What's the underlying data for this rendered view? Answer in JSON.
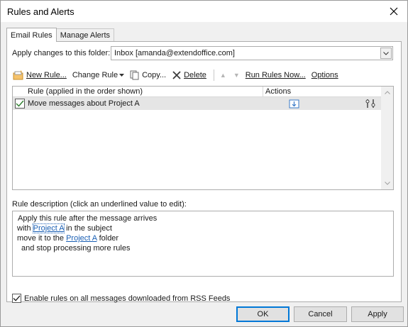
{
  "window": {
    "title": "Rules and Alerts"
  },
  "tabs": [
    {
      "label": "Email Rules",
      "active": true
    },
    {
      "label": "Manage Alerts",
      "active": false
    }
  ],
  "folder": {
    "label": "Apply changes to this folder:",
    "value": "Inbox [amanda@extendoffice.com]"
  },
  "toolbar": {
    "new_rule": "New Rule...",
    "change_rule": "Change Rule",
    "copy": "Copy...",
    "delete": "Delete",
    "run_rules": "Run Rules Now...",
    "options": "Options"
  },
  "list": {
    "col_rule": "Rule (applied in the order shown)",
    "col_actions": "Actions",
    "rows": [
      {
        "name": "Move messages about Project A",
        "checked": true
      }
    ]
  },
  "description": {
    "label": "Rule description (click an underlined value to edit):",
    "line1": "Apply this rule after the message arrives",
    "line2_prefix": "with ",
    "line2_link": "Project A",
    "line2_suffix": " in the subject",
    "line3_prefix": "move it to the ",
    "line3_link": "Project A",
    "line3_suffix": " folder",
    "line4": "and stop processing more rules"
  },
  "rss": {
    "label": "Enable rules on all messages downloaded from RSS Feeds",
    "checked": true
  },
  "buttons": {
    "ok": "OK",
    "cancel": "Cancel",
    "apply": "Apply"
  },
  "colors": {
    "link": "#1a5fb4",
    "default_button_border": "#0078d7",
    "selected_row": "#e5e5e5"
  }
}
